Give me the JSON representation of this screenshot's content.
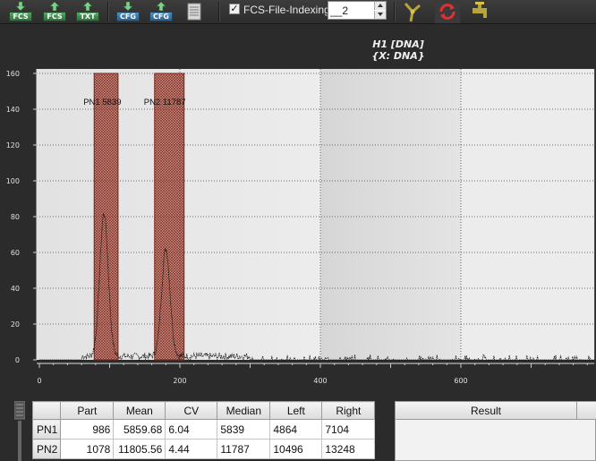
{
  "toolbar": {
    "buttons": [
      {
        "name": "load-fcs-button",
        "label": "FCS",
        "icon": "download-arrow-icon"
      },
      {
        "name": "save-fcs-button",
        "label": "FCS",
        "icon": "upload-arrow-icon"
      },
      {
        "name": "export-txt-button",
        "label": "TXT",
        "icon": "upload-arrow-icon"
      },
      {
        "name": "load-cfg-button",
        "label": "CFG",
        "icon": "download-arrow-icon"
      },
      {
        "name": "save-cfg-button",
        "label": "CFG",
        "icon": "upload-arrow-icon"
      }
    ],
    "print_icon": "printer-icon",
    "fcs_indexing": {
      "label": "FCS-File-Indexing",
      "checked": true,
      "value": "__2"
    },
    "tool_icons": [
      "gate-tool-icon",
      "refresh-icon",
      "faucet-icon"
    ]
  },
  "chart_data": {
    "type": "histogram",
    "title": "H1 [DNA]",
    "subtitle": "{X: DNA}",
    "xlabel": "",
    "ylabel": "",
    "xlim": [
      0,
      790
    ],
    "ylim": [
      0,
      160
    ],
    "x_ticks": [
      0,
      200,
      400,
      600
    ],
    "y_ticks": [
      0,
      20,
      40,
      60,
      80,
      100,
      120,
      140,
      160
    ],
    "grid": true,
    "gates": [
      {
        "label": "PN1 5839",
        "x_start": 78,
        "x_end": 112
      },
      {
        "label": "PN2 11787",
        "x_start": 164,
        "x_end": 206
      }
    ],
    "peaks": [
      {
        "center": 92,
        "height": 80
      },
      {
        "center": 180,
        "height": 60
      }
    ],
    "background_level": 1,
    "accent_color": "#b04a3a"
  },
  "table": {
    "columns": [
      "",
      "Part",
      "Mean",
      "CV",
      "Median",
      "Left",
      "Right"
    ],
    "rows": [
      {
        "name": "PN1",
        "part": "986",
        "mean": "5859.68",
        "cv": "6.04",
        "median": "5839",
        "left": "4864",
        "right": "7104"
      },
      {
        "name": "PN2",
        "part": "1078",
        "mean": "11805.56",
        "cv": "4.44",
        "median": "11787",
        "left": "10496",
        "right": "13248"
      }
    ]
  },
  "result": {
    "header": "Result"
  }
}
